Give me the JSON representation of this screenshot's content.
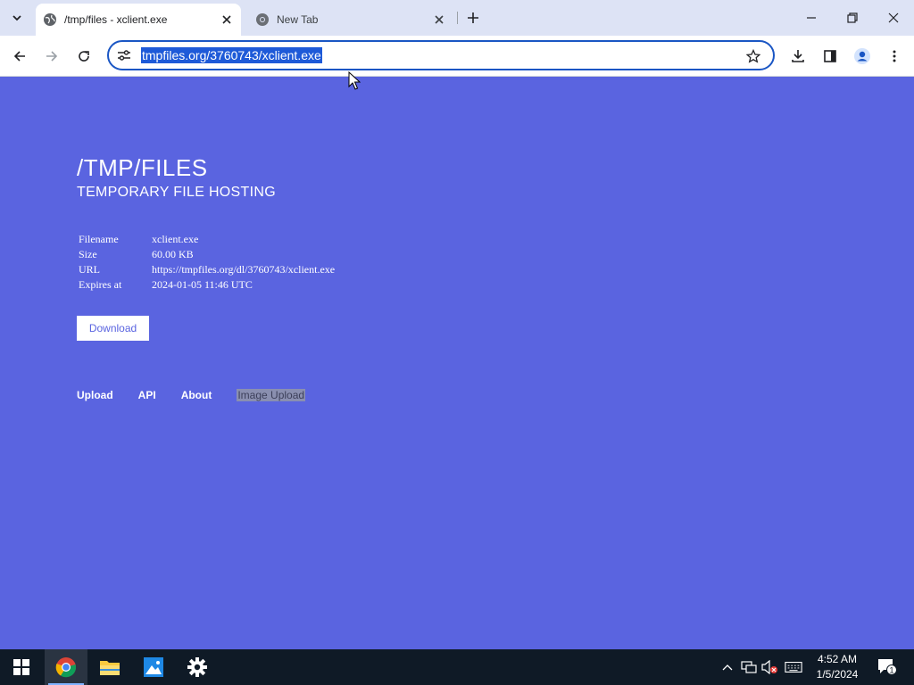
{
  "browser": {
    "tabs": [
      {
        "title": "/tmp/files - xclient.exe",
        "active": true
      },
      {
        "title": "New Tab",
        "active": false
      }
    ],
    "url": "tmpfiles.org/3760743/xclient.exe"
  },
  "page": {
    "title": "/TMP/FILES",
    "subtitle": "TEMPORARY FILE HOSTING",
    "file_info": [
      {
        "label": "Filename",
        "value": "xclient.exe"
      },
      {
        "label": "Size",
        "value": "60.00 KB"
      },
      {
        "label": "URL",
        "value": "https://tmpfiles.org/dl/3760743/xclient.exe"
      },
      {
        "label": "Expires at",
        "value": "2024-01-05 11:46 UTC"
      }
    ],
    "download_label": "Download",
    "footer_links": [
      "Upload",
      "API",
      "About",
      "Image Upload"
    ]
  },
  "taskbar": {
    "time": "4:52 AM",
    "date": "1/5/2024",
    "notification_count": "1"
  },
  "colors": {
    "page_bg": "#5a64e0",
    "url_highlight": "#1e5ad8"
  }
}
